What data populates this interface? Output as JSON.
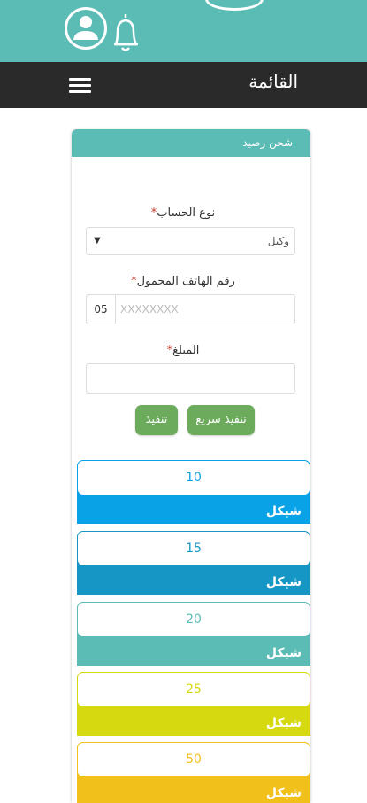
{
  "header": {
    "menu_title": "القائمة"
  },
  "icons": {
    "avatar": "user-avatar-icon",
    "bell": "bell-icon",
    "menu": "hamburger-menu-icon",
    "dropdown": "chevron-down-icon"
  },
  "colors": {
    "teal": "#5bbcb5",
    "nav": "#2a2a2a",
    "button_green": "#6cab5c",
    "required": "#c0392b"
  },
  "form": {
    "card_title": "شحن رصيد",
    "account_type_label": "نوع الحساب",
    "account_type_value": "وكيل",
    "phone_label": "رقم الهاتف المحمول",
    "phone_prefix": "05",
    "phone_placeholder": "XXXXXXXX",
    "amount_label": "المبلغ",
    "required_mark": "*",
    "quick_button": "تنفيذ سريع",
    "exec_button": "تنفيذ"
  },
  "packages": [
    {
      "value": "10",
      "currency": "شيكل",
      "color": "#0aa2e6"
    },
    {
      "value": "15",
      "currency": "شيكل",
      "color": "#1596c4"
    },
    {
      "value": "20",
      "currency": "شيكل",
      "color": "#5bbcb5"
    },
    {
      "value": "25",
      "currency": "شيكل",
      "color": "#d6d90f"
    },
    {
      "value": "50",
      "currency": "شيكل",
      "color": "#f2c01a"
    }
  ]
}
